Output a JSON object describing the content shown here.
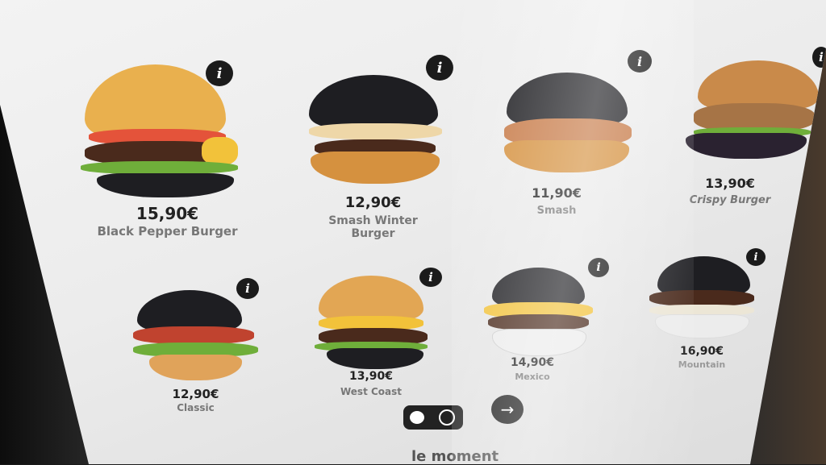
{
  "menu": {
    "items": [
      {
        "price": "15,90€",
        "name": "Black Pepper Burger",
        "bun": "sesame",
        "info_icon": "info-icon"
      },
      {
        "price": "12,90€",
        "name": "Smash Winter Burger",
        "bun": "black",
        "info_icon": "info-icon"
      },
      {
        "price": "11,90€",
        "name": "Smash",
        "bun": "black",
        "info_icon": "info-icon"
      },
      {
        "price": "13,90€",
        "name": "Crispy Burger",
        "bun": "brioche",
        "info_icon": "info-icon"
      },
      {
        "price": "12,90€",
        "name": "Classic",
        "bun": "black",
        "info_icon": "info-icon"
      },
      {
        "price": "13,90€",
        "name": "West Coast",
        "bun": "sesame",
        "info_icon": "info-icon"
      },
      {
        "price": "14,90€",
        "name": "Mexico",
        "bun": "black",
        "info_icon": "info-icon"
      },
      {
        "price": "16,90€",
        "name": "Mountain",
        "bun": "black",
        "info_icon": "info-icon"
      }
    ]
  },
  "controls": {
    "toggle_icon": "toggle-switch-icon",
    "next_icon": "arrow-right-icon",
    "next_glyph": "→"
  },
  "footer": {
    "text": "le moment"
  },
  "colors": {
    "sesame_bun": "#e9b04e",
    "black_bun": "#1e1e22",
    "brioche_bun": "#c98a4a",
    "patty": "#4a2a1c",
    "lettuce": "#6fae3a",
    "cheese": "#f2c23a",
    "price_text": "#222222",
    "name_text": "#777777"
  }
}
